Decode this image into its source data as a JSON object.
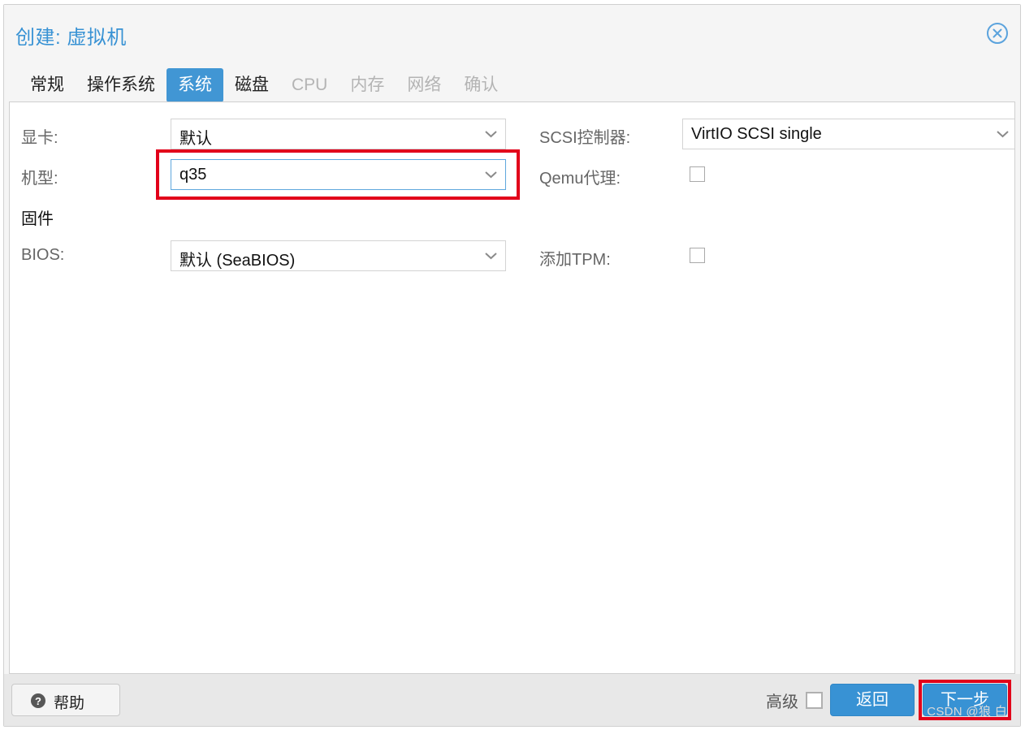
{
  "dialog": {
    "title": "创建: 虚拟机",
    "close_icon": "close-circle-icon"
  },
  "tabs": [
    {
      "label": "常规",
      "state": "enabled"
    },
    {
      "label": "操作系统",
      "state": "enabled"
    },
    {
      "label": "系统",
      "state": "active"
    },
    {
      "label": "磁盘",
      "state": "enabled"
    },
    {
      "label": "CPU",
      "state": "disabled"
    },
    {
      "label": "内存",
      "state": "disabled"
    },
    {
      "label": "网络",
      "state": "disabled"
    },
    {
      "label": "确认",
      "state": "disabled"
    }
  ],
  "form": {
    "left": {
      "graphic_card": {
        "label": "显卡:",
        "value": "默认"
      },
      "machine": {
        "label": "机型:",
        "value": "q35",
        "highlighted": true
      },
      "firmware": {
        "label": "固件"
      },
      "bios": {
        "label": "BIOS:",
        "value": "默认 (SeaBIOS)"
      }
    },
    "right": {
      "scsi_controller": {
        "label": "SCSI控制器:",
        "value": "VirtIO SCSI single"
      },
      "qemu_agent": {
        "label": "Qemu代理:",
        "checked": false
      },
      "add_tpm": {
        "label": "添加TPM:",
        "checked": false
      }
    }
  },
  "footer": {
    "help_label": "帮助",
    "advanced_label": "高级",
    "advanced_checked": false,
    "back_label": "返回",
    "next_label": "下一步",
    "next_highlighted": true
  },
  "watermark": "CSDN @狼 白",
  "colors": {
    "accent_blue": "#3892d4",
    "tab_active_bg": "#4196d4",
    "highlight_red": "#e2001a",
    "panel_bg": "#f5f5f5",
    "footer_bg": "#e8e8e8",
    "field_border": "#d3d3d3",
    "focus_border": "#5fa7dd",
    "label_gray": "#666666"
  }
}
